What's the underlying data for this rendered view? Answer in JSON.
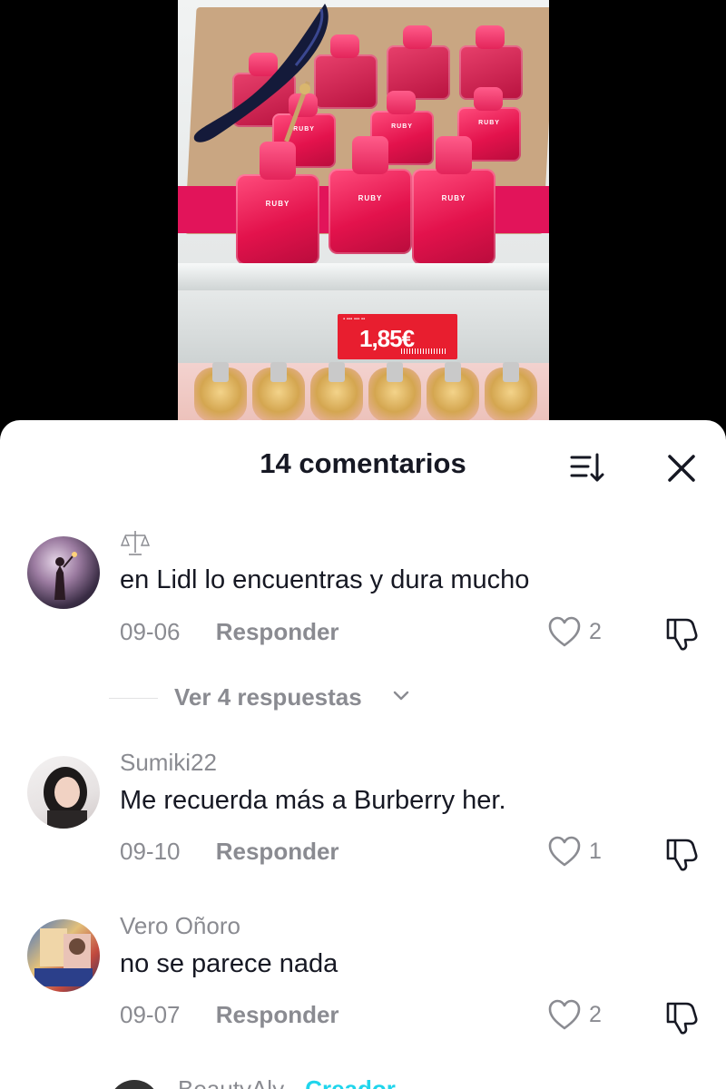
{
  "video": {
    "bottle_label": "RUBY",
    "price": "1,85€"
  },
  "sheet": {
    "title": "14 comentarios"
  },
  "comments": [
    {
      "username_icon": "scales-icon",
      "text": "en Lidl lo encuentras y dura mucho",
      "date": "09-06",
      "reply_label": "Responder",
      "likes": "2"
    },
    {
      "username": "Sumiki22",
      "text": "Me recuerda más a Burberry her.",
      "date": "09-10",
      "reply_label": "Responder",
      "likes": "1"
    },
    {
      "username": "Vero Oñoro",
      "text": "no se parece nada",
      "date": "09-07",
      "reply_label": "Responder",
      "likes": "2"
    }
  ],
  "view_replies": "Ver 4 respuestas",
  "next_comment": {
    "username": "BeautyAly",
    "separator": " · ",
    "badge": "Creador"
  },
  "colors": {
    "accent_creator": "#20d5ec",
    "price_tag": "#e81e2f",
    "text_primary": "#161823",
    "text_secondary": "#8a8b91"
  }
}
